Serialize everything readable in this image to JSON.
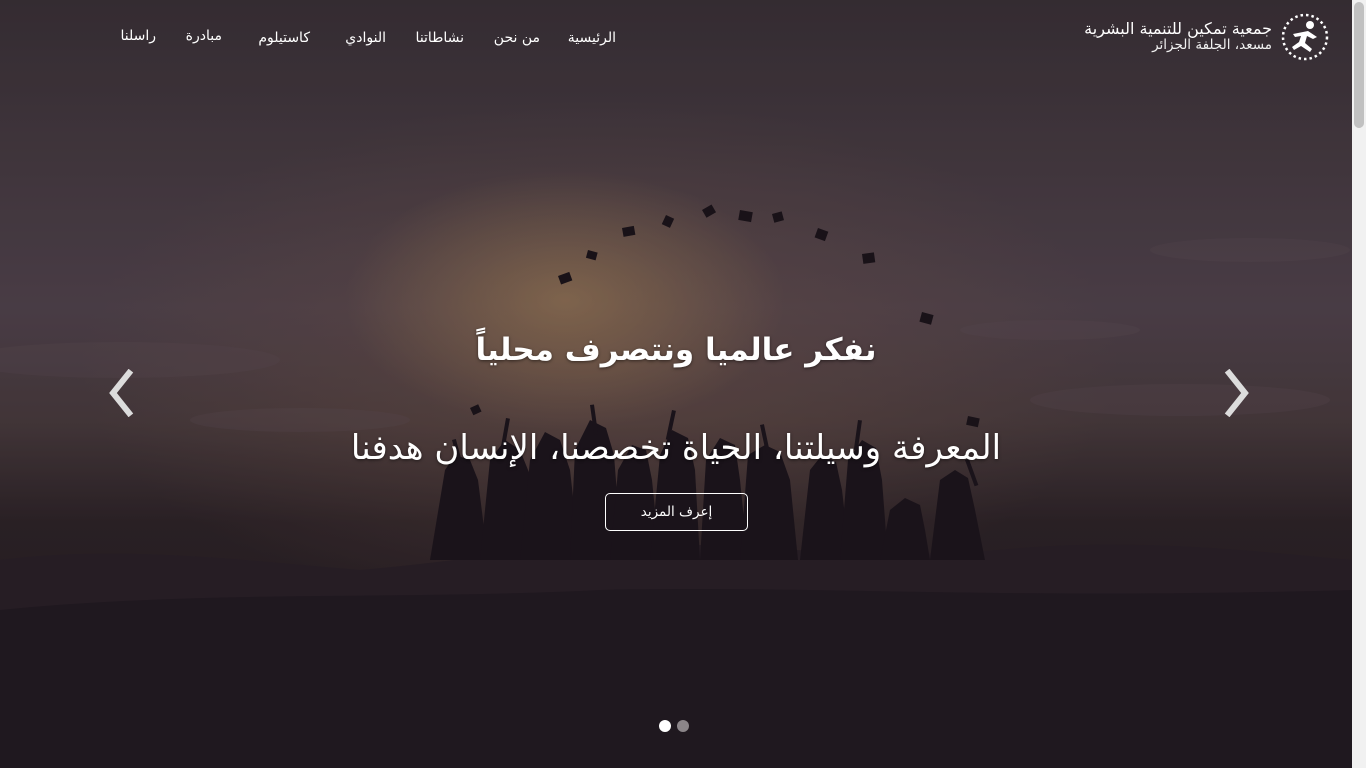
{
  "brand": {
    "line1": "جمعية تمكين للتنمية البشرية",
    "line2": "مسعد، الجلفة الجزائر",
    "logo_icon": "running-person-icon"
  },
  "nav": {
    "items": [
      {
        "label": "الرئيسية"
      },
      {
        "label": "من نحن"
      },
      {
        "label": "نشاطاتنا"
      },
      {
        "label": "النوادي"
      },
      {
        "label": "كاستيلوم"
      },
      {
        "label": "مبادرة"
      },
      {
        "label": "راسلنا"
      }
    ]
  },
  "hero": {
    "headline": "نفكر عالميا ونتصرف محلياً",
    "subline": "المعرفة وسيلتنا، الحياة تخصصنا، الإنسان هدفنا",
    "cta_label": "إعرف المزيد",
    "prev_icon": "chevron-left-icon",
    "next_icon": "chevron-right-icon",
    "slide_count": 2,
    "active_slide": 1
  },
  "colors": {
    "text": "#ffffff",
    "overlay": "#241d24",
    "dot_inactive": "#8b8589"
  }
}
